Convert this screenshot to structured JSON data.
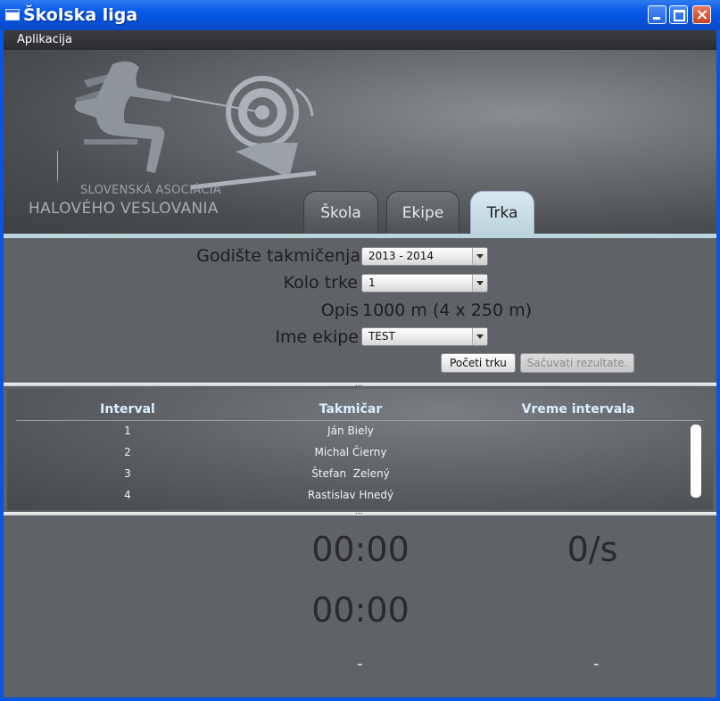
{
  "window": {
    "title": "Školska liga"
  },
  "menu": {
    "items": [
      "Aplikacija"
    ]
  },
  "banner": {
    "logo_line1": "SLOVENSKÁ ASOCIÁCIA",
    "logo_line2": "HALOVÉHO VESLOVANIA"
  },
  "tabs": [
    {
      "label": "Škola",
      "active": false
    },
    {
      "label": "Ekipe",
      "active": false
    },
    {
      "label": "Trka",
      "active": true
    }
  ],
  "form": {
    "season_label": "Godište takmičenja",
    "season_value": "2013 - 2014",
    "round_label": "Kolo trke",
    "round_value": "1",
    "description_label": "Opis",
    "description_value": "1000 m (4 x 250 m)",
    "team_label": "Ime ekipe",
    "team_value": "TEST",
    "start_button": "Početi trku",
    "save_button": "Sačuvati rezultate."
  },
  "table": {
    "columns": [
      "Interval",
      "Takmičar",
      "Vreme intervala"
    ],
    "rows": [
      {
        "interval": "1",
        "competitor": "Ján Biely",
        "time": ""
      },
      {
        "interval": "2",
        "competitor": "Michal Čierny",
        "time": ""
      },
      {
        "interval": "3",
        "competitor": "Štefan  Zelený",
        "time": ""
      },
      {
        "interval": "4",
        "competitor": "Rastislav Hnedý",
        "time": ""
      }
    ]
  },
  "splitter_glyph": "...",
  "timers": {
    "time_main": "00:00",
    "rate": "0/s",
    "time_second": "00:00",
    "dash_left": "-",
    "dash_right": "-"
  },
  "colors": {
    "titlebar": "#0a5ce8",
    "active_tab": "#bcd4dc",
    "header_text": "#ddeeff"
  }
}
